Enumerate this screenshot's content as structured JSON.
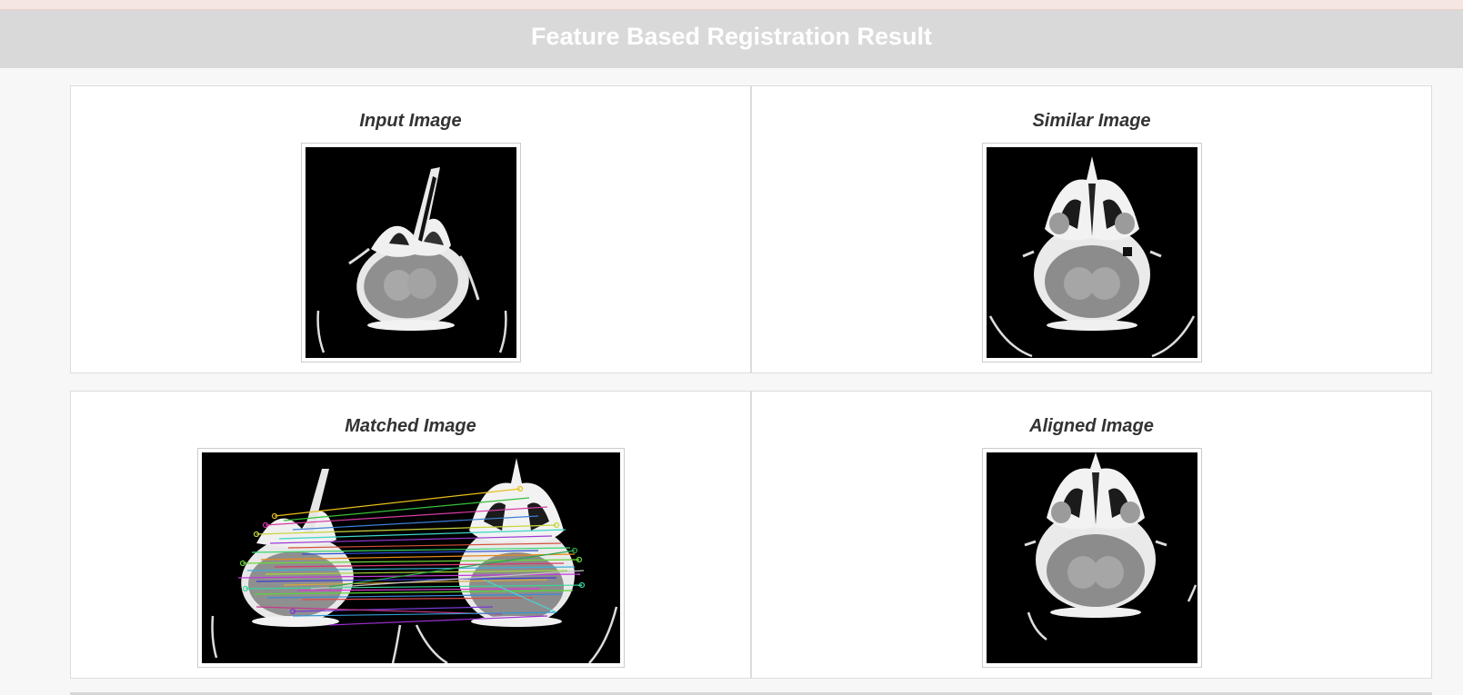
{
  "header": {
    "title": "Feature Based Registration Result"
  },
  "panels": {
    "input": {
      "title": "Input Image",
      "image_alt": "CT brain scan - input"
    },
    "similar": {
      "title": "Similar Image",
      "image_alt": "CT brain scan - similar"
    },
    "matched": {
      "title": "Matched Image",
      "image_alt": "Keypoint matches between input and similar scans"
    },
    "aligned": {
      "title": "Aligned Image",
      "image_alt": "CT brain scan - aligned"
    }
  }
}
